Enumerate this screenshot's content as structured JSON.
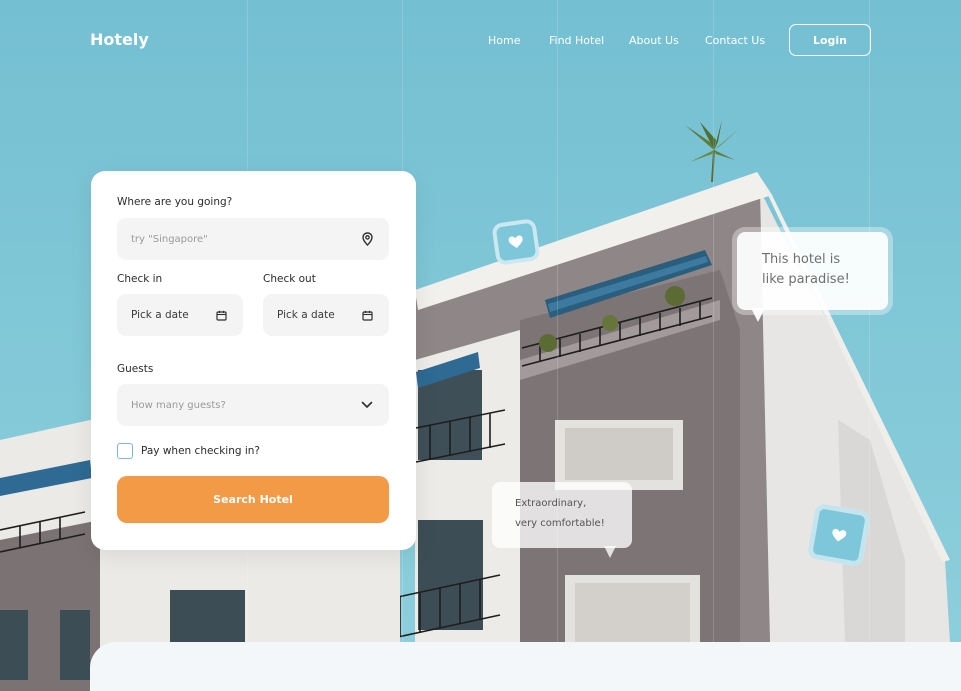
{
  "brand": "Hotely",
  "nav": {
    "home": "Home",
    "find_hotel": "Find Hotel",
    "about_us": "About Us",
    "contact_us": "Contact Us",
    "login": "Login"
  },
  "search": {
    "destination_label": "Where are you going?",
    "destination_placeholder": "try \"Singapore\"",
    "checkin_label": "Check in",
    "checkin_value": "Pick a date",
    "checkout_label": "Check out",
    "checkout_value": "Pick a date",
    "guests_label": "Guests",
    "guests_placeholder": "How many guests?",
    "pay_checkbox_label": "Pay when checking in?",
    "pay_checked": false,
    "submit_label": "Search Hotel"
  },
  "reviews": [
    "This hotel is like paradise!",
    "Extraordinary, very comfortable!"
  ],
  "colors": {
    "sky": "#7ec3d3",
    "accent": "#f39a47",
    "checkbox_border": "#7fb7d8",
    "heart_badge": "#7ec6da"
  },
  "icons": [
    "location-pin-icon",
    "calendar-icon",
    "chevron-down-icon",
    "heart-icon"
  ]
}
